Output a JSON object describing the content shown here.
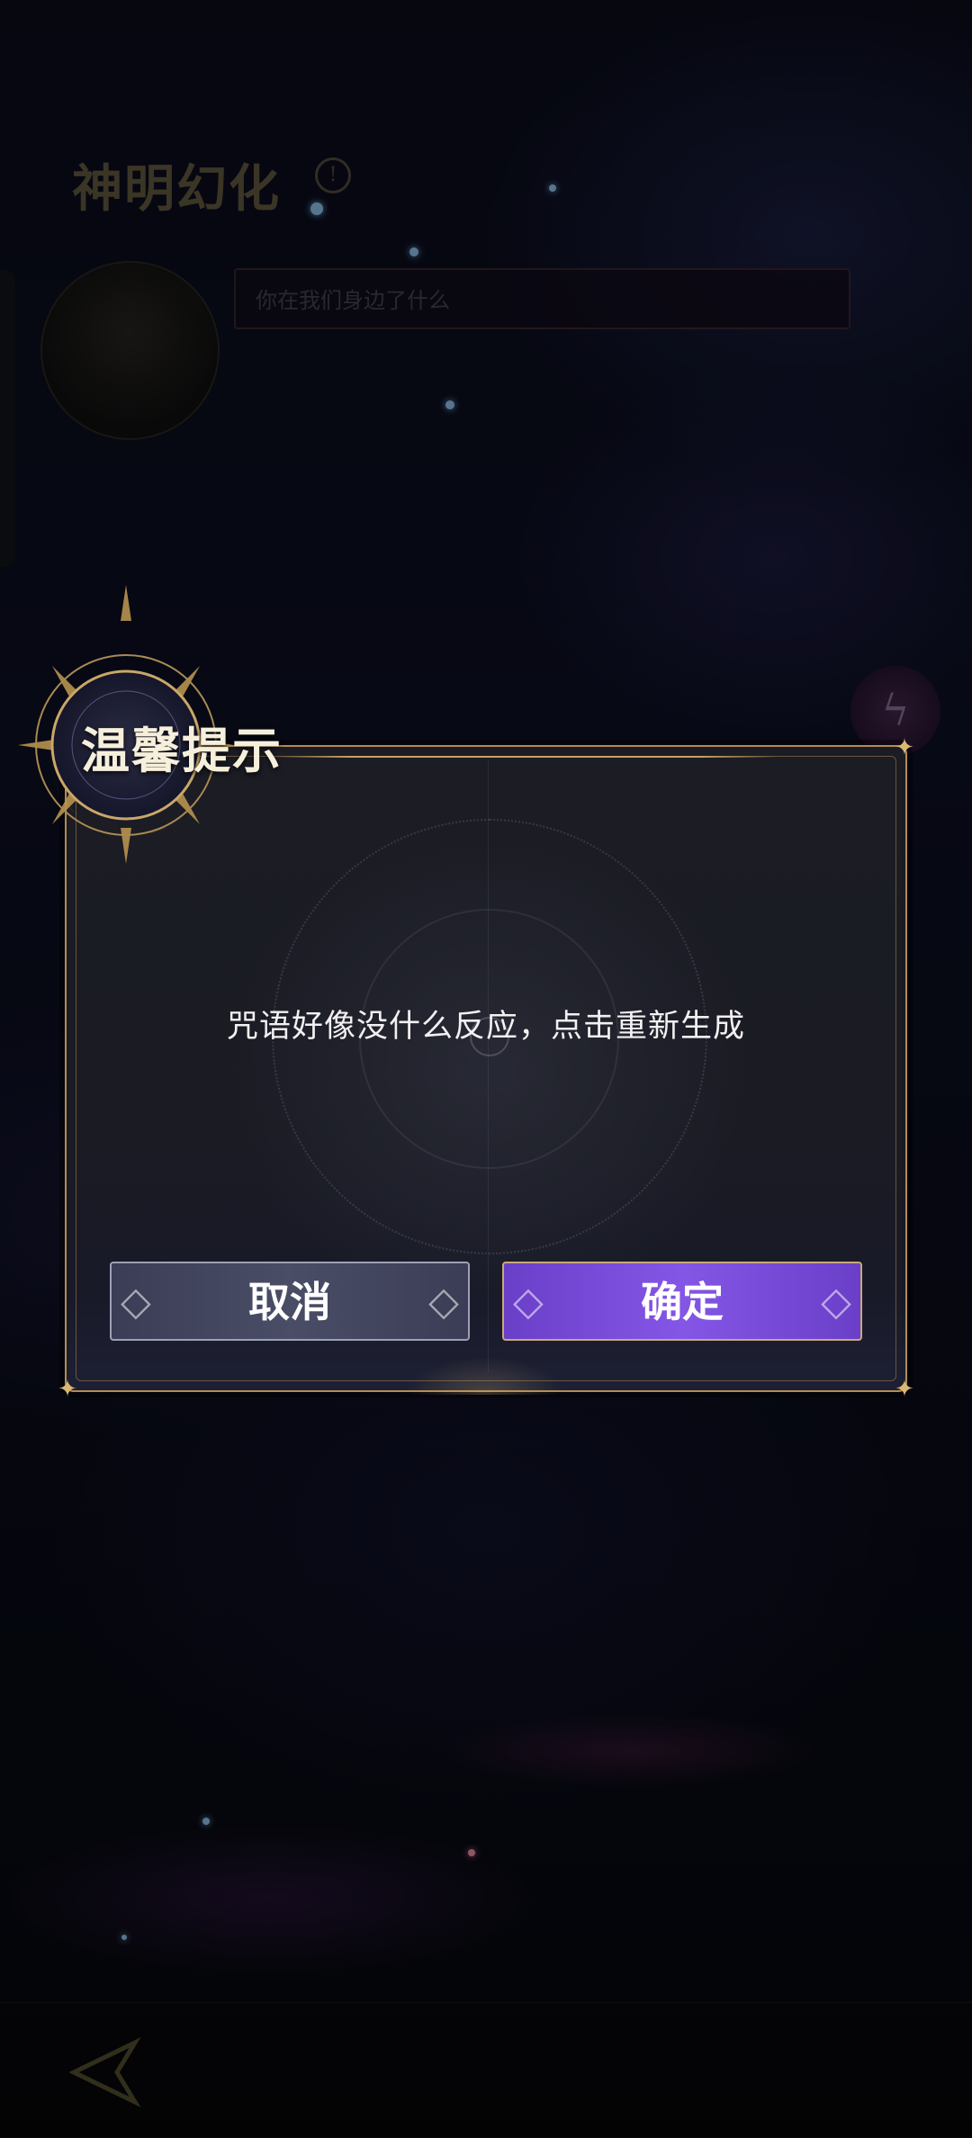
{
  "page": {
    "title": "神明幻化",
    "info_icon": "info-icon",
    "prompt_placeholder": "你在我们身边了什么",
    "side_button_icon": "lightning-icon",
    "back_icon": "back-arrow-icon"
  },
  "dialog": {
    "title": "温馨提示",
    "message": "咒语好像没什么反应，点击重新生成",
    "cancel_label": "取消",
    "confirm_label": "确定"
  },
  "colors": {
    "gold_accent": "#c9a060",
    "confirm_purple": "#7a4ed8",
    "cancel_slate": "#44475e",
    "background": "#0b0d1d"
  }
}
